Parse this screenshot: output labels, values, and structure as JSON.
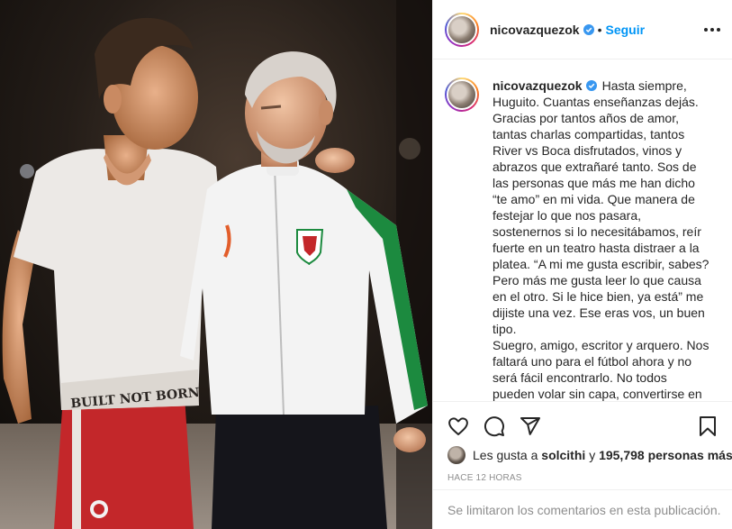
{
  "post": {
    "username": "nicovazquezok",
    "separator": "•",
    "follow_label": "Seguir",
    "caption_lines": [
      "Hasta siempre,",
      "Huguito. Cuantas enseñanzas dejás.",
      "Gracias por tantos años de amor,",
      "tantas charlas compartidas, tantos",
      "River vs Boca disfrutados, vinos y",
      "abrazos que extrañaré tanto. Sos de",
      "las personas que más me han dicho",
      "“te amo” en mi vida. Que manera de",
      "festejar lo que nos pasara,",
      "sostenernos si lo necesitábamos, reír",
      "fuerte en un teatro hasta distraer a la",
      "platea. “A mi me gusta escribir, sabes?",
      "Pero más me gusta leer lo que causa",
      "en el otro. Si le hice bien, ya está” me",
      "dijiste una vez. Ese eras vos, un buen",
      "tipo.",
      "Suegro, amigo, escritor y arquero. Nos",
      "faltará uno para el fútbol ahora y no",
      "será fácil encontrarlo. No todos",
      "pueden volar sin capa, convertirse en"
    ],
    "likes_prefix": "Les gusta a",
    "likes_user": "solcithi",
    "likes_conjunction": "y",
    "likes_count": "195,798 personas más",
    "timestamp": "HACE 12 HORAS",
    "comments_disabled": "Se limitaron los comentarios en esta publicación."
  },
  "colors": {
    "accent": "#0095f6",
    "verified": "#3897f0",
    "muted": "#8e8e8e",
    "text": "#262626"
  },
  "icons": {
    "verified": "verified-badge-icon",
    "more": "more-options-icon",
    "like": "heart-icon",
    "comment": "comment-icon",
    "share": "paper-plane-icon",
    "save": "bookmark-icon"
  }
}
